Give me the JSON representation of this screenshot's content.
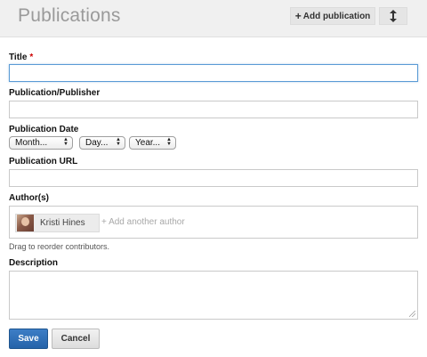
{
  "header": {
    "title": "Publications",
    "add_publication_label": "Add publication",
    "add_publication_icon": "plus-icon",
    "sort_icon": "up-down-arrow-icon"
  },
  "form": {
    "title": {
      "label": "Title",
      "required_mark": "*",
      "value": ""
    },
    "publisher": {
      "label": "Publication/Publisher",
      "value": ""
    },
    "date": {
      "label": "Publication Date",
      "month": "Month...",
      "day": "Day...",
      "year": "Year..."
    },
    "url": {
      "label": "Publication URL",
      "value": ""
    },
    "authors": {
      "label": "Author(s)",
      "chips": [
        {
          "name": "Kristi Hines"
        }
      ],
      "add_placeholder": "+ Add another author",
      "hint": "Drag to reorder contributors."
    },
    "description": {
      "label": "Description",
      "value": ""
    }
  },
  "actions": {
    "save_label": "Save",
    "cancel_label": "Cancel"
  },
  "colors": {
    "primary_button": "#2f6fb6",
    "focus_border": "#5b9bd5",
    "required": "#cc0000"
  }
}
